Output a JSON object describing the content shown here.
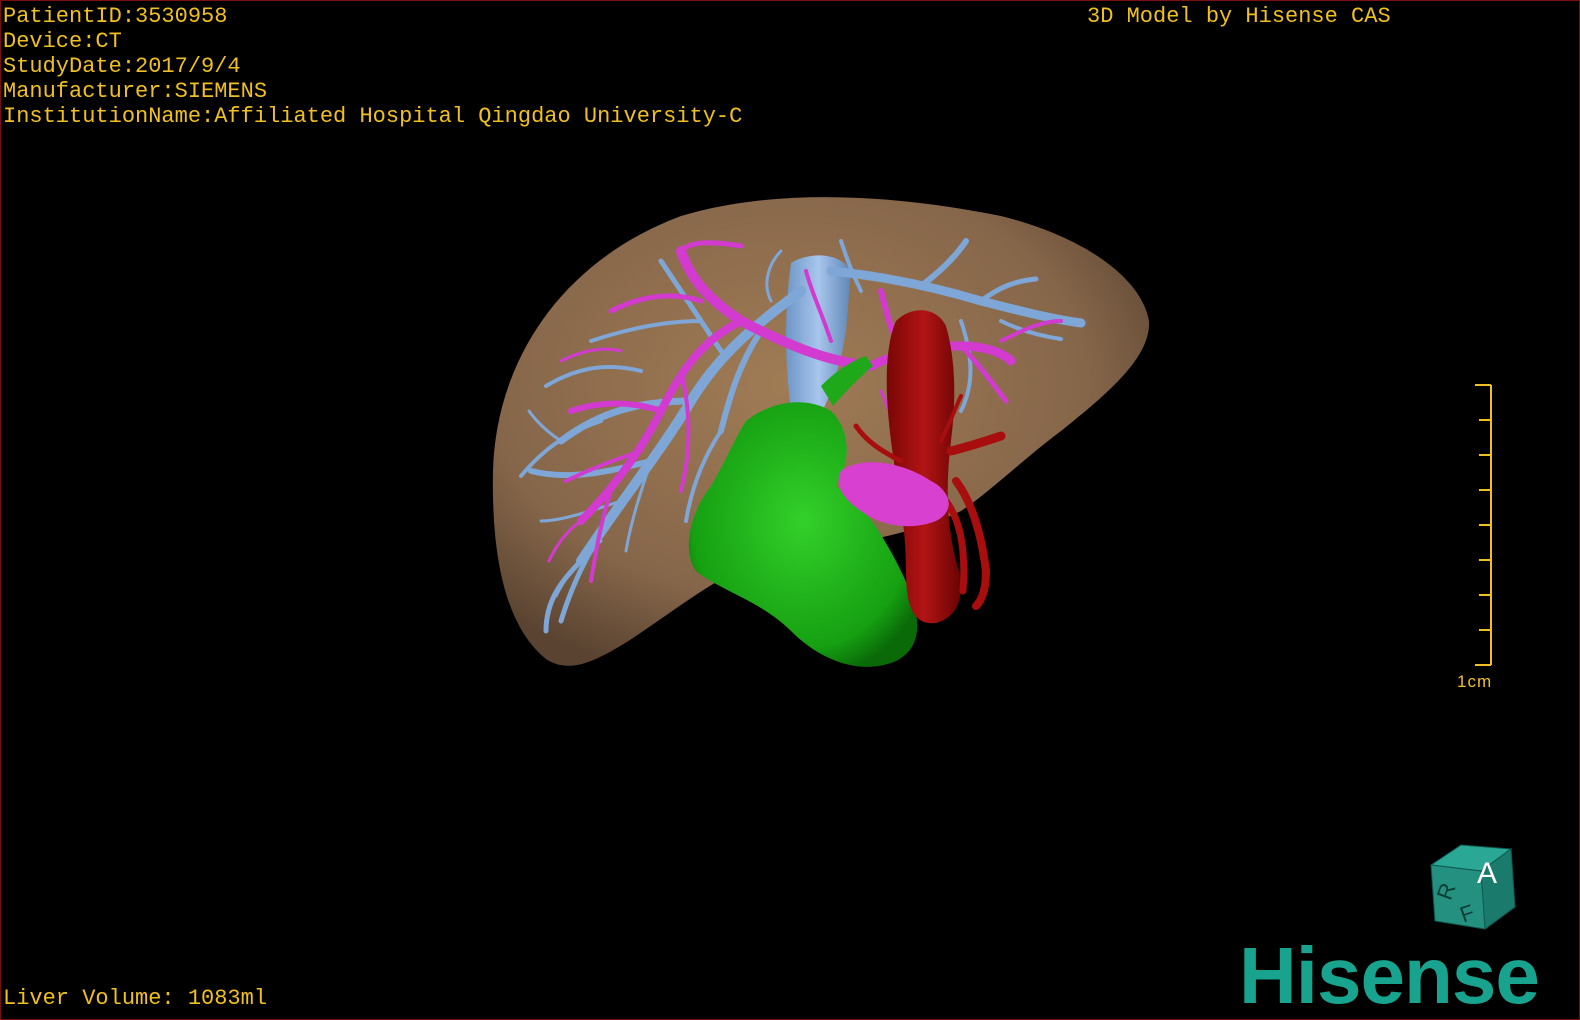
{
  "patient_info": {
    "patient_id": "PatientID:3530958",
    "device": "Device:CT",
    "study_date": "StudyDate:2017/9/4",
    "manufacturer": "Manufacturer:SIEMENS",
    "institution": "InstitutionName:Affiliated Hospital Qingdao University-C"
  },
  "model_credit": "3D Model by Hisense CAS",
  "liver_volume": "Liver Volume: 1083ml",
  "scale_bar": {
    "label": "1cm"
  },
  "orientation_cube": {
    "front_label": "A",
    "top_label": "R",
    "side_label": "F"
  },
  "brand": "Hisense",
  "colors": {
    "overlay_text": "#f0c020",
    "liver": "#8a6a48",
    "hepatic_vein": "#7ea6d6",
    "portal_vein": "#d23ad0",
    "aorta_artery": "#9c0c0c",
    "gallbladder_duodenum": "#1fa81a",
    "cube": "#1f8f80",
    "brand": "#17a38e"
  }
}
